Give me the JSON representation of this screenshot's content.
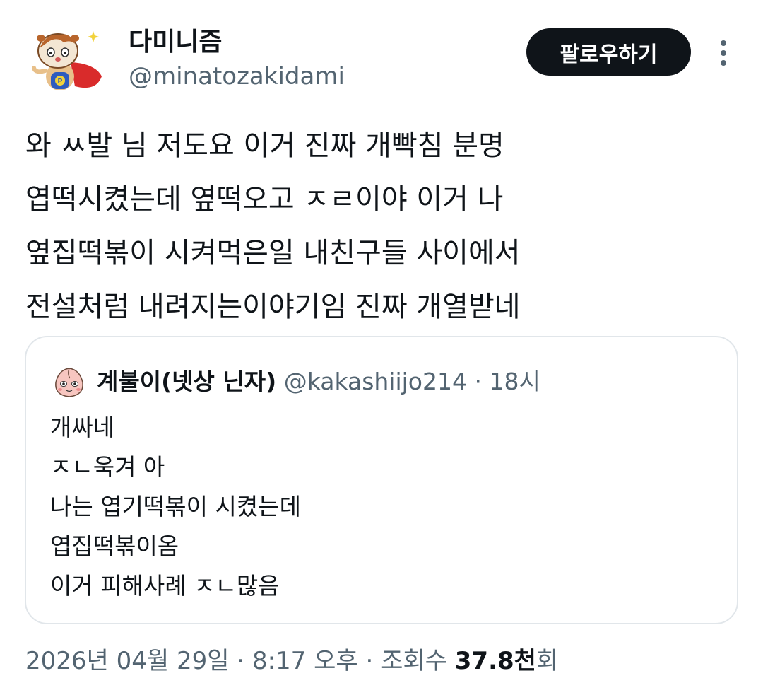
{
  "author": {
    "display_name": "다미니즘",
    "handle": "@minatozakidami",
    "avatar_icon": "cartoon-hamster-superhero-avatar"
  },
  "actions": {
    "follow_label": "팔로우하기",
    "more_icon": "more-vertical-icon"
  },
  "tweet": {
    "lines": [
      "와 ㅆ발 님 저도요 이거 진짜 개빡침 분명",
      "엽떡시켰는데 옆떡오고 ㅈㄹ이야  이거 나",
      "옆집떡볶이 시켜먹은일 내친구들 사이에서",
      "전설처럼 내려지는이야기임 진짜 개열받네"
    ]
  },
  "quote": {
    "avatar_icon": "cartoon-peach-face-avatar",
    "display_name": "계불이(넷상 닌자)",
    "handle": "@kakashiijo214",
    "separator": " · ",
    "time": "18시",
    "lines": [
      "개싸네",
      "ㅈㄴ욱겨 아",
      "나는 엽기떡볶이 시켰는데",
      "엽집떡볶이옴",
      "이거 피해사례 ㅈㄴ많음"
    ]
  },
  "footer": {
    "date": "2026년 04월 29일",
    "sep1": " · ",
    "time": "8:17 오후",
    "sep2": " · ",
    "views_label": "조회수 ",
    "views_count": "37.8천",
    "views_suffix": "회"
  },
  "colors": {
    "text_primary": "#0f1419",
    "text_secondary": "#536471",
    "border": "#e1e6ea",
    "button_bg": "#0f1419"
  }
}
